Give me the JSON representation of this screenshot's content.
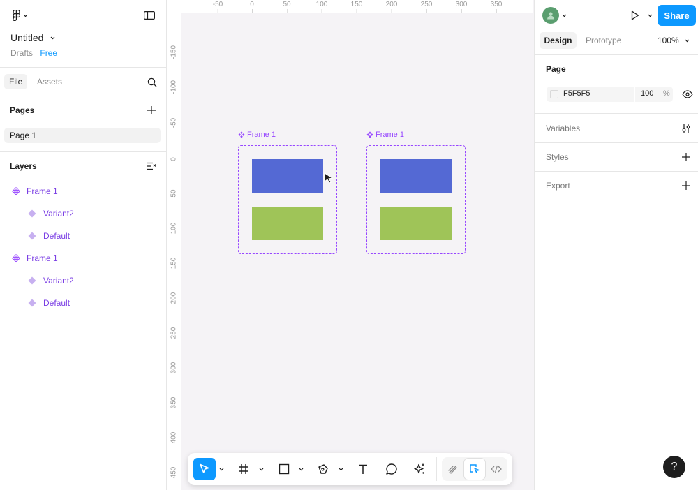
{
  "app": {
    "file_name": "Untitled",
    "location": "Drafts",
    "plan": "Free"
  },
  "left_panel": {
    "tabs": [
      "File",
      "Assets"
    ],
    "pages_label": "Pages",
    "pages": [
      "Page 1"
    ],
    "layers_label": "Layers",
    "layers": [
      {
        "label": "Frame 1",
        "type": "component-set",
        "depth": 0
      },
      {
        "label": "Variant2",
        "type": "variant",
        "depth": 1
      },
      {
        "label": "Default",
        "type": "variant",
        "depth": 1
      },
      {
        "label": "Frame 1",
        "type": "component-set",
        "depth": 0
      },
      {
        "label": "Variant2",
        "type": "variant",
        "depth": 1
      },
      {
        "label": "Default",
        "type": "variant",
        "depth": 1
      }
    ]
  },
  "rulers": {
    "top": [
      "-50",
      "0",
      "50",
      "100",
      "150",
      "200",
      "250",
      "300",
      "350"
    ],
    "left": [
      "-150",
      "-100",
      "-50",
      "0",
      "50",
      "100",
      "150",
      "200",
      "250",
      "300",
      "350",
      "400",
      "450"
    ]
  },
  "canvas": {
    "frames": [
      {
        "title": "Frame 1"
      },
      {
        "title": "Frame 1"
      }
    ],
    "colors": {
      "frame_border": "#9747ff",
      "rect_top": "#5469d4",
      "rect_bottom": "#9fc458"
    }
  },
  "toolbar": {
    "tools": [
      "move-tool",
      "frame-tool",
      "rectangle-tool",
      "pen-tool",
      "text-tool",
      "comment-tool",
      "actions-tool"
    ],
    "modes": [
      "draw-mode",
      "design-mode",
      "dev-mode"
    ],
    "active_tool": "move-tool",
    "active_mode": "design-mode",
    "accent": "#0d99ff"
  },
  "right_panel": {
    "share_label": "Share",
    "tabs": [
      "Design",
      "Prototype"
    ],
    "zoom": "100%",
    "page_section": "Page",
    "page_color": "F5F5F5",
    "page_opacity": "100",
    "percent_sign": "%",
    "sections": [
      "Variables",
      "Styles",
      "Export"
    ]
  },
  "help_label": "?"
}
